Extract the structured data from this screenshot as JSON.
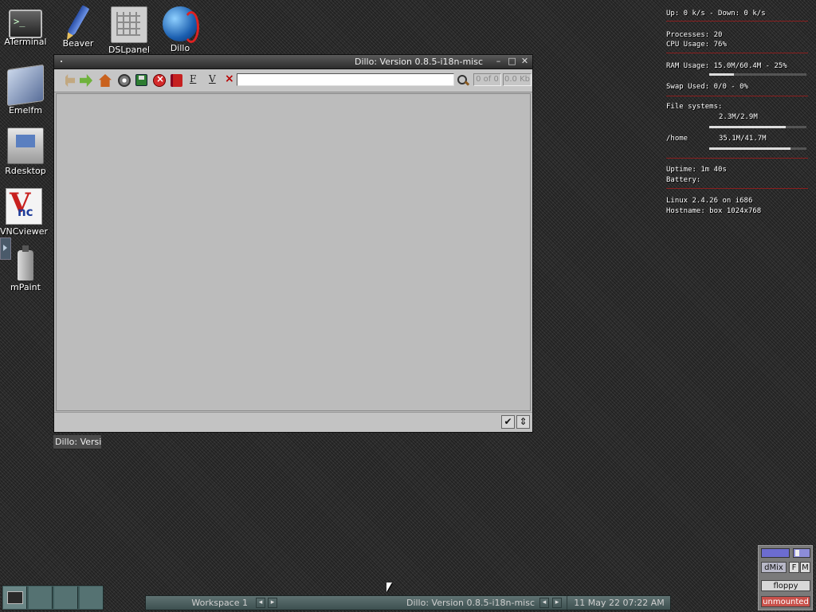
{
  "desktop": {
    "icons": [
      {
        "label": "ATerminal",
        "icon": "terminal-icon"
      },
      {
        "label": "Beaver",
        "icon": "pen-icon"
      },
      {
        "label": "DSLpanel",
        "icon": "control-panel-icon"
      },
      {
        "label": "Dillo",
        "icon": "globe-icon"
      },
      {
        "label": "Emelfm",
        "icon": "file-manager-icon"
      },
      {
        "label": "Rdesktop",
        "icon": "computer-icon"
      },
      {
        "label": "VNCviewer",
        "icon": "vnc-icon"
      },
      {
        "label": "mPaint",
        "icon": "spray-can-icon"
      }
    ]
  },
  "dillo": {
    "title": "Dillo: Version 0.8.5-i18n-misc",
    "toolbar": {
      "f_label": "F",
      "v_label": "V",
      "clear_label": "×",
      "url_value": "",
      "images_progress": "0 of 0",
      "page_progress": "0.0 Kb"
    },
    "status_text": "",
    "tooltip": "Dillo: Versi",
    "status_buttons": {
      "check": "✔",
      "expand": "⇕"
    }
  },
  "sysmon": {
    "network": "Up: 0 k/s  - Down: 0 k/s",
    "processes": "Processes: 20",
    "cpu": "CPU Usage: 76%",
    "ram": "RAM Usage: 15.0M/60.4M - 25%",
    "ram_fraction": 0.25,
    "swap": "Swap Used: 0/0 - 0%",
    "fs_title": "File systems:",
    "root_usage": "2.3M/2.9M",
    "root_fraction": 0.79,
    "home_label": "/home",
    "home_usage": "35.1M/41.7M",
    "home_fraction": 0.84,
    "uptime": "Uptime:   1m 40s",
    "battery": "Battery:",
    "kernel": "Linux 2.4.26 on i686",
    "hostname": "Hostname: box 1024x768"
  },
  "dock": {
    "dmix_label": "dMix",
    "f_label": "F",
    "m_label": "M",
    "floppy_label": "floppy",
    "unmounted_label": "unmounted"
  },
  "taskbar": {
    "workspace": "Workspace 1",
    "task": "Dillo: Version 0.8.5-i18n-misc",
    "clock": "11 May 22 07:22 AM",
    "prev": "◂",
    "next": "▸"
  }
}
